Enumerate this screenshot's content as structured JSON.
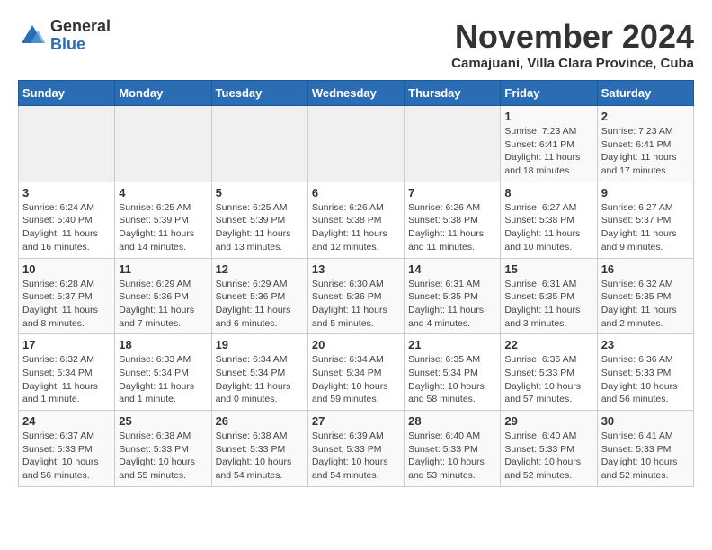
{
  "logo": {
    "general": "General",
    "blue": "Blue"
  },
  "header": {
    "month": "November 2024",
    "location": "Camajuani, Villa Clara Province, Cuba"
  },
  "weekdays": [
    "Sunday",
    "Monday",
    "Tuesday",
    "Wednesday",
    "Thursday",
    "Friday",
    "Saturday"
  ],
  "weeks": [
    [
      {
        "day": "",
        "info": ""
      },
      {
        "day": "",
        "info": ""
      },
      {
        "day": "",
        "info": ""
      },
      {
        "day": "",
        "info": ""
      },
      {
        "day": "",
        "info": ""
      },
      {
        "day": "1",
        "info": "Sunrise: 7:23 AM\nSunset: 6:41 PM\nDaylight: 11 hours and 18 minutes."
      },
      {
        "day": "2",
        "info": "Sunrise: 7:23 AM\nSunset: 6:41 PM\nDaylight: 11 hours and 17 minutes."
      }
    ],
    [
      {
        "day": "3",
        "info": "Sunrise: 6:24 AM\nSunset: 5:40 PM\nDaylight: 11 hours and 16 minutes."
      },
      {
        "day": "4",
        "info": "Sunrise: 6:25 AM\nSunset: 5:39 PM\nDaylight: 11 hours and 14 minutes."
      },
      {
        "day": "5",
        "info": "Sunrise: 6:25 AM\nSunset: 5:39 PM\nDaylight: 11 hours and 13 minutes."
      },
      {
        "day": "6",
        "info": "Sunrise: 6:26 AM\nSunset: 5:38 PM\nDaylight: 11 hours and 12 minutes."
      },
      {
        "day": "7",
        "info": "Sunrise: 6:26 AM\nSunset: 5:38 PM\nDaylight: 11 hours and 11 minutes."
      },
      {
        "day": "8",
        "info": "Sunrise: 6:27 AM\nSunset: 5:38 PM\nDaylight: 11 hours and 10 minutes."
      },
      {
        "day": "9",
        "info": "Sunrise: 6:27 AM\nSunset: 5:37 PM\nDaylight: 11 hours and 9 minutes."
      }
    ],
    [
      {
        "day": "10",
        "info": "Sunrise: 6:28 AM\nSunset: 5:37 PM\nDaylight: 11 hours and 8 minutes."
      },
      {
        "day": "11",
        "info": "Sunrise: 6:29 AM\nSunset: 5:36 PM\nDaylight: 11 hours and 7 minutes."
      },
      {
        "day": "12",
        "info": "Sunrise: 6:29 AM\nSunset: 5:36 PM\nDaylight: 11 hours and 6 minutes."
      },
      {
        "day": "13",
        "info": "Sunrise: 6:30 AM\nSunset: 5:36 PM\nDaylight: 11 hours and 5 minutes."
      },
      {
        "day": "14",
        "info": "Sunrise: 6:31 AM\nSunset: 5:35 PM\nDaylight: 11 hours and 4 minutes."
      },
      {
        "day": "15",
        "info": "Sunrise: 6:31 AM\nSunset: 5:35 PM\nDaylight: 11 hours and 3 minutes."
      },
      {
        "day": "16",
        "info": "Sunrise: 6:32 AM\nSunset: 5:35 PM\nDaylight: 11 hours and 2 minutes."
      }
    ],
    [
      {
        "day": "17",
        "info": "Sunrise: 6:32 AM\nSunset: 5:34 PM\nDaylight: 11 hours and 1 minute."
      },
      {
        "day": "18",
        "info": "Sunrise: 6:33 AM\nSunset: 5:34 PM\nDaylight: 11 hours and 1 minute."
      },
      {
        "day": "19",
        "info": "Sunrise: 6:34 AM\nSunset: 5:34 PM\nDaylight: 11 hours and 0 minutes."
      },
      {
        "day": "20",
        "info": "Sunrise: 6:34 AM\nSunset: 5:34 PM\nDaylight: 10 hours and 59 minutes."
      },
      {
        "day": "21",
        "info": "Sunrise: 6:35 AM\nSunset: 5:34 PM\nDaylight: 10 hours and 58 minutes."
      },
      {
        "day": "22",
        "info": "Sunrise: 6:36 AM\nSunset: 5:33 PM\nDaylight: 10 hours and 57 minutes."
      },
      {
        "day": "23",
        "info": "Sunrise: 6:36 AM\nSunset: 5:33 PM\nDaylight: 10 hours and 56 minutes."
      }
    ],
    [
      {
        "day": "24",
        "info": "Sunrise: 6:37 AM\nSunset: 5:33 PM\nDaylight: 10 hours and 56 minutes."
      },
      {
        "day": "25",
        "info": "Sunrise: 6:38 AM\nSunset: 5:33 PM\nDaylight: 10 hours and 55 minutes."
      },
      {
        "day": "26",
        "info": "Sunrise: 6:38 AM\nSunset: 5:33 PM\nDaylight: 10 hours and 54 minutes."
      },
      {
        "day": "27",
        "info": "Sunrise: 6:39 AM\nSunset: 5:33 PM\nDaylight: 10 hours and 54 minutes."
      },
      {
        "day": "28",
        "info": "Sunrise: 6:40 AM\nSunset: 5:33 PM\nDaylight: 10 hours and 53 minutes."
      },
      {
        "day": "29",
        "info": "Sunrise: 6:40 AM\nSunset: 5:33 PM\nDaylight: 10 hours and 52 minutes."
      },
      {
        "day": "30",
        "info": "Sunrise: 6:41 AM\nSunset: 5:33 PM\nDaylight: 10 hours and 52 minutes."
      }
    ]
  ]
}
